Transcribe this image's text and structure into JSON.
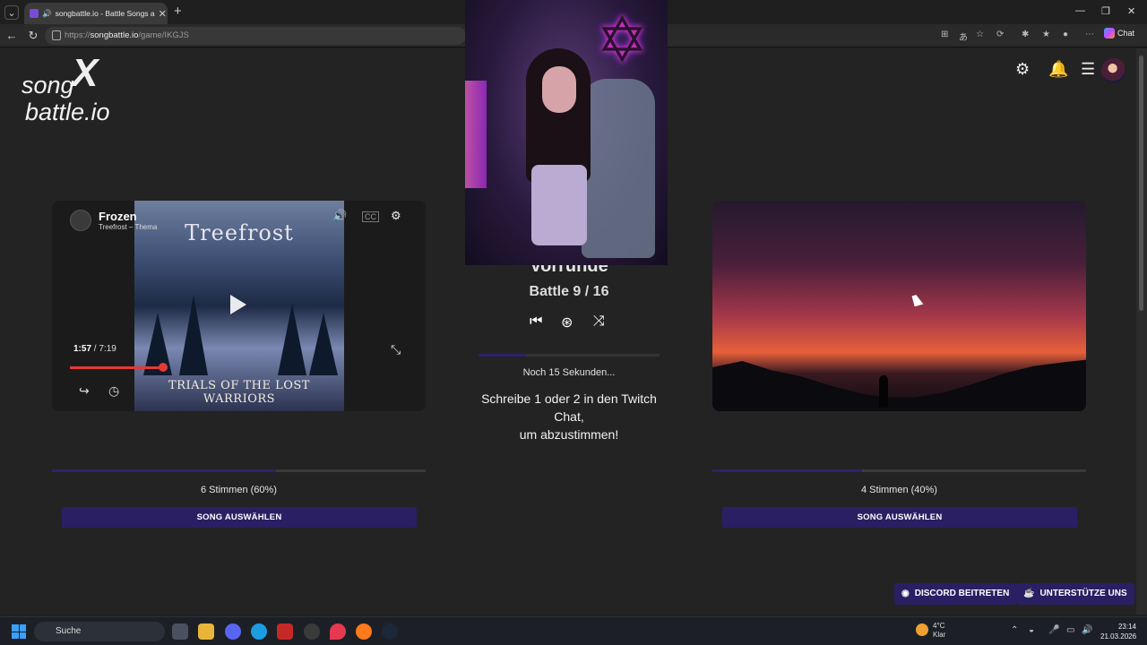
{
  "browser": {
    "tab_title": "songbattle.io - Battle Songs a",
    "url_prefix": "https://",
    "url_host": "songbattle.io",
    "url_path": "/game/IKGJS",
    "chat_label": "Chat"
  },
  "logo": {
    "line1": "song",
    "line2": "battle.io",
    "mark": "X"
  },
  "left_song": {
    "title": "Frozen",
    "channel": "Treefrost – Thema",
    "current_time": "1:57",
    "duration": "/ 7:19",
    "progress": 0.27,
    "art_brand": "Treefrost",
    "art_caption": "TRIALS OF THE LOST WARRIORS",
    "votes": "6 Stimmen (60%)",
    "vote_fraction": 0.6,
    "button": "SONG AUSWÄHLEN"
  },
  "right_song": {
    "votes": "4 Stimmen (40%)",
    "vote_fraction": 0.4,
    "button": "SONG AUSWÄHLEN"
  },
  "center": {
    "round_title": "Vorrunde",
    "battle": "Battle 9 / 16",
    "countdown": "Noch 15 Sekunden...",
    "instruction_line1": "Schreibe 1 oder 2 in den Twitch Chat,",
    "instruction_line2": "um abzustimmen!",
    "timer_fraction": 0.26
  },
  "footer_buttons": {
    "discord": "DISCORD BEITRETEN",
    "support": "UNTERSTÜTZE UNS"
  },
  "taskbar": {
    "search_placeholder": "Suche",
    "temperature": "4°C",
    "weather": "Klar",
    "time": "23:14",
    "date": "21.03.2026"
  },
  "colors": {
    "accent": "#2a1f63",
    "progress_red": "#e53935"
  }
}
